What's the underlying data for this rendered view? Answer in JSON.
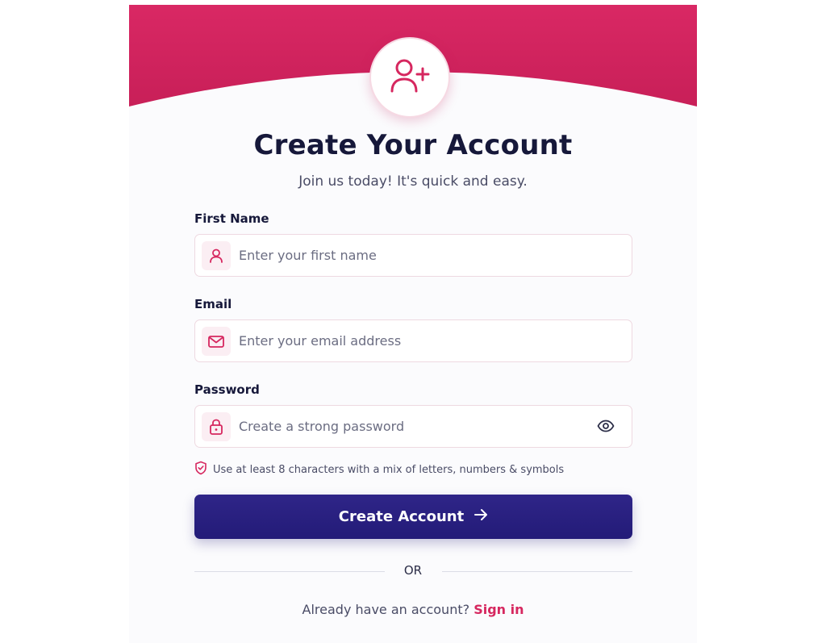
{
  "colors": {
    "brand_pink": "#d6275f",
    "brand_pink_dark": "#c41e56",
    "primary_navy": "#231b78",
    "heading_text": "#16183a",
    "body_text": "#4a4c66"
  },
  "header": {
    "icon": "user-plus-icon",
    "title": "Create Your Account",
    "subtitle": "Join us today! It's quick and easy."
  },
  "form": {
    "first_name": {
      "label": "First Name",
      "icon": "user-icon",
      "placeholder": "Enter your first name",
      "value": ""
    },
    "email": {
      "label": "Email",
      "icon": "mail-icon",
      "placeholder": "Enter your email address",
      "value": ""
    },
    "password": {
      "label": "Password",
      "icon": "lock-icon",
      "placeholder": "Create a strong password",
      "value": "",
      "toggle_icon": "eye-icon"
    },
    "password_hint": {
      "icon": "shield-check-icon",
      "text": "Use at least 8 characters with a mix of letters, numbers & symbols"
    },
    "submit": {
      "label": "Create Account",
      "icon": "arrow-right-icon"
    }
  },
  "divider": {
    "text": "OR"
  },
  "footer": {
    "prompt": "Already have an account?",
    "link_label": "Sign in"
  }
}
